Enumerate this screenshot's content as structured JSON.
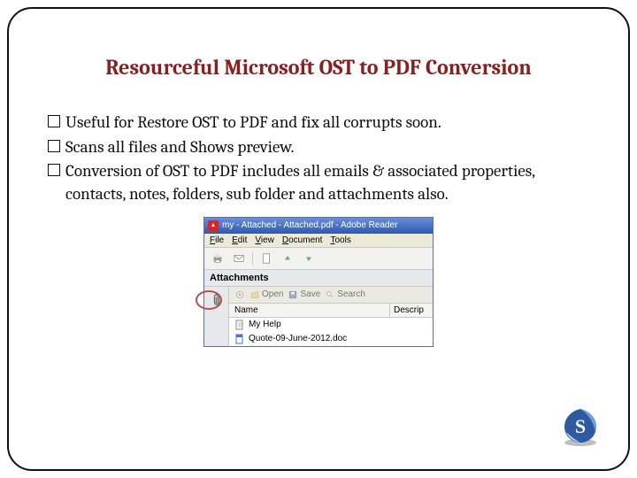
{
  "slide": {
    "title": "Resourceful Microsoft OST to PDF Conversion",
    "bullets": [
      "Useful for Restore OST to PDF and fix all corrupts soon.",
      "Scans all files and Shows preview.",
      "Conversion of OST to PDF includes all emails & associated properties, contacts, notes, folders, sub folder and attachments also."
    ]
  },
  "reader": {
    "titlebar": "my - Attached - Attached.pdf - Adobe Reader",
    "menu": {
      "file": "File",
      "edit": "Edit",
      "view": "View",
      "document": "Document",
      "tools": "Tools"
    },
    "panelHeader": "Attachments",
    "actions": {
      "open": "Open",
      "save": "Save",
      "search": "Search"
    },
    "columns": {
      "name": "Name",
      "descrip": "Descrip"
    },
    "files": [
      "My Help",
      "Quote-09-June-2012.doc"
    ]
  },
  "logo": {
    "letter": "S"
  }
}
